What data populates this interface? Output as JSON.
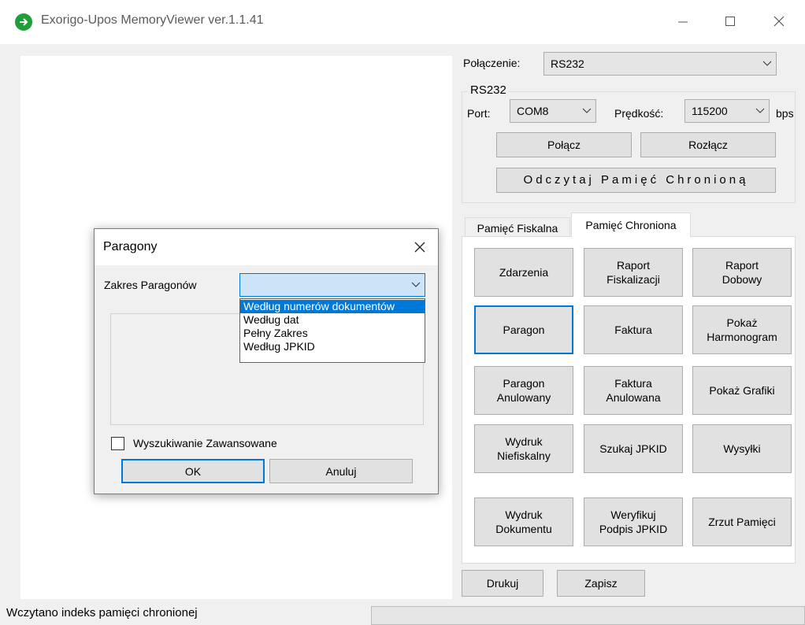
{
  "window": {
    "title": "Exorigo-Upos MemoryViewer ver.1.1.41",
    "minimize_glyph": "—",
    "maximize_glyph": "☐",
    "close_glyph": "✕"
  },
  "connection": {
    "label": "Połączenie:",
    "value": "RS232"
  },
  "rs232": {
    "group_label": "RS232",
    "port_label": "Port:",
    "port_value": "COM8",
    "speed_label": "Prędkość:",
    "speed_value": "115200",
    "speed_unit": "bps",
    "connect_button": "Połącz",
    "disconnect_button": "Rozłącz",
    "read_button": "Odczytaj Pamięć Chronioną"
  },
  "tabs": [
    {
      "label": "Pamięć Fiskalna",
      "active": false
    },
    {
      "label": "Pamięć Chroniona",
      "active": true
    }
  ],
  "grid_buttons": [
    [
      "Zdarzenia",
      "Raport\nFiskalizacji",
      "Raport\nDobowy"
    ],
    [
      "Paragon",
      "Faktura",
      "Pokaż\nHarmonogram"
    ],
    [
      "Paragon\nAnulowany",
      "Faktura\nAnulowana",
      "Pokaż Grafiki"
    ],
    [
      "Wydruk\nNiefiskalny",
      "Szukaj JPKID",
      "Wysyłki"
    ],
    [
      "Wydruk\nDokumentu",
      "Weryfikuj\nPodpis JPKID",
      "Zrzut Pamięci"
    ]
  ],
  "bottom_buttons": {
    "print": "Drukuj",
    "save": "Zapisz"
  },
  "status": {
    "text": "Wczytano indeks pamięci chronionej"
  },
  "dialog": {
    "title": "Paragony",
    "range_label": "Zakres Paragonów",
    "range_value": "",
    "options": [
      "Według numerów dokumentów",
      "Według dat",
      "Pełny Zakres",
      "Według JPKID"
    ],
    "selected_option_index": 0,
    "advanced_search_label": "Wyszukiwanie Zawansowane",
    "advanced_search_checked": false,
    "ok_button": "OK",
    "cancel_button": "Anuluj"
  },
  "colors": {
    "accent": "#0078d7",
    "button_face": "#e1e1e1",
    "window_bg": "#f0f0f0"
  }
}
